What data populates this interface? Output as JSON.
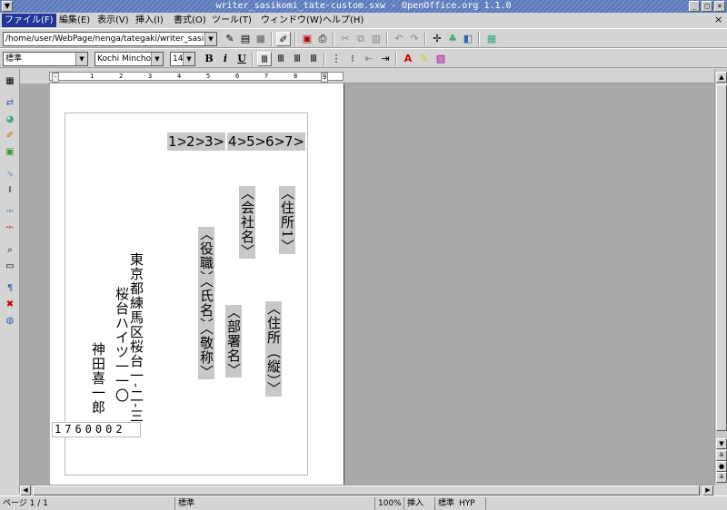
{
  "window": {
    "title": "writer_sasikomi_tate-custom.sxw - OpenOffice.org 1.1.0",
    "system_menu_icon": "chevron-down-icon",
    "controls": [
      "_",
      "□",
      "×"
    ]
  },
  "menubar": {
    "items": [
      {
        "label": "ファイル(F)",
        "active": true
      },
      {
        "label": "編集(E)"
      },
      {
        "label": "表示(V)"
      },
      {
        "label": "挿入(I)"
      },
      {
        "label": "書式(O)"
      },
      {
        "label": "ツール(T)"
      },
      {
        "label": "ウィンドウ(W)"
      },
      {
        "label": "ヘルプ(H)"
      }
    ],
    "close_label": "×"
  },
  "toolbar": {
    "path": "/home/user/WebPage/nenga/tategaki/writer_sasiko",
    "paragraph_style": "標準",
    "font_name": "Kochi Mincho",
    "font_size": "14",
    "bold": "B",
    "italic": "i",
    "underline": "U",
    "dropdown_arrow": "▼"
  },
  "ruler": {
    "start": "·",
    "ticks": [
      "1",
      "2",
      "3",
      "4",
      "5",
      "6",
      "7",
      "8",
      "9"
    ]
  },
  "document": {
    "numbers": [
      "1>",
      "2>",
      "3>",
      "4>",
      "5>",
      "6>",
      "7>"
    ],
    "address1": "〈住所1〉",
    "company": "〈会社名〉",
    "title": "〈役職〉",
    "name": "〈氏名〉",
    "honorific": "〈敬称〉",
    "department": "〈部署名〉",
    "address_vertical": "〈住所（縦）〉",
    "sender_address1": "東京都練馬区桜台一-二-三",
    "sender_address2": "桜台ハイツ一一〇",
    "sender_name": "神田喜一郎",
    "postal_code": "1760002"
  },
  "statusbar": {
    "page": "ページ 1 / 1",
    "style": "標準",
    "zoom": "100%",
    "insert_mode": "挿入",
    "selection_mode": "標準",
    "hyperlink_mode": "HYP"
  }
}
